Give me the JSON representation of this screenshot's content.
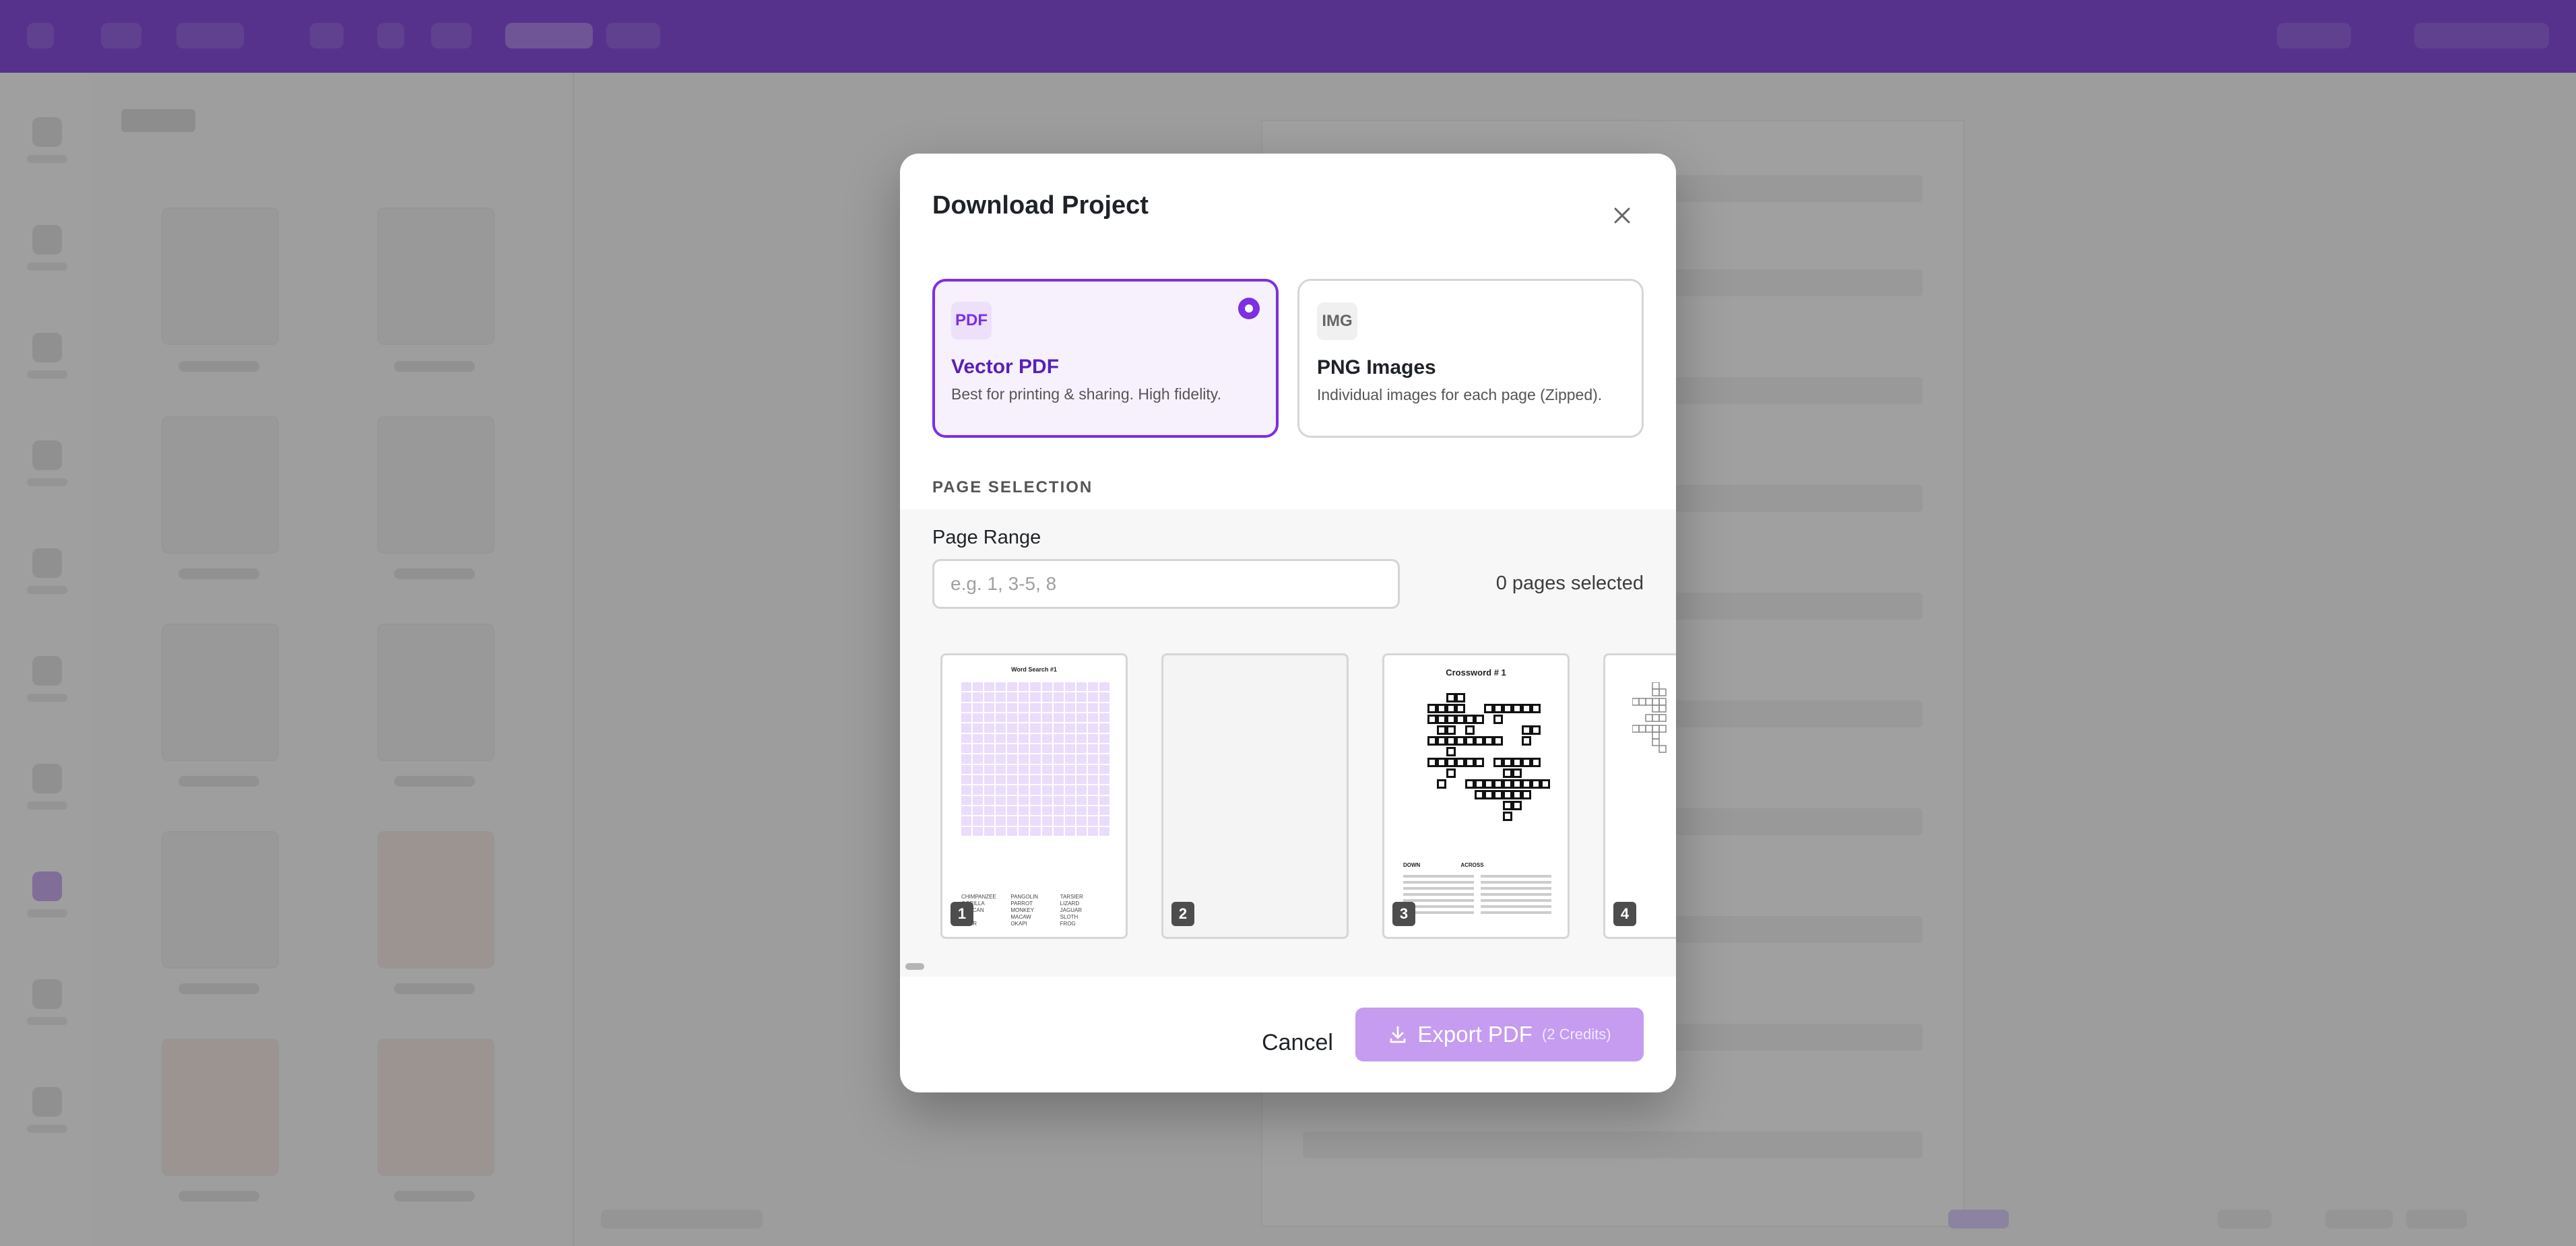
{
  "modal": {
    "title": "Download Project",
    "formats": [
      {
        "badge": "PDF",
        "title": "Vector PDF",
        "description": "Best for printing & sharing. High fidelity.",
        "selected": true
      },
      {
        "badge": "IMG",
        "title": "PNG Images",
        "description": "Individual images for each page (Zipped).",
        "selected": false
      }
    ],
    "section_label": "PAGE SELECTION",
    "page_range": {
      "label": "Page Range",
      "placeholder": "e.g. 1, 3-5, 8",
      "value": "",
      "selected_count": "0 pages selected"
    },
    "thumbnails": [
      {
        "number": "1",
        "title": "Word Search #1",
        "words": [
          "CHIMPANZEE",
          "PANGOLIN",
          "TARSIER",
          "GORILLA",
          "PARROT",
          "LIZARD",
          "TOUCAN",
          "MONKEY",
          "JAGUAR",
          "BOA",
          "MACAW",
          "SLOTH",
          "TAPIR",
          "OKAPI",
          "FROG"
        ]
      },
      {
        "number": "2",
        "title": ""
      },
      {
        "number": "3",
        "title": "Crossword # 1",
        "clue_headers": [
          "DOWN",
          "ACROSS"
        ]
      },
      {
        "number": "4",
        "title": ""
      }
    ],
    "buttons": {
      "cancel": "Cancel",
      "export": "Export PDF",
      "export_credits": "(2 Credits)"
    }
  },
  "colors": {
    "accent": "#7c2fe3",
    "accent_light": "#c59cf0",
    "topbar": "#6d2ad0"
  },
  "icons": {
    "close": "close-icon",
    "download": "download-icon",
    "radio": "radio-selected-icon"
  }
}
